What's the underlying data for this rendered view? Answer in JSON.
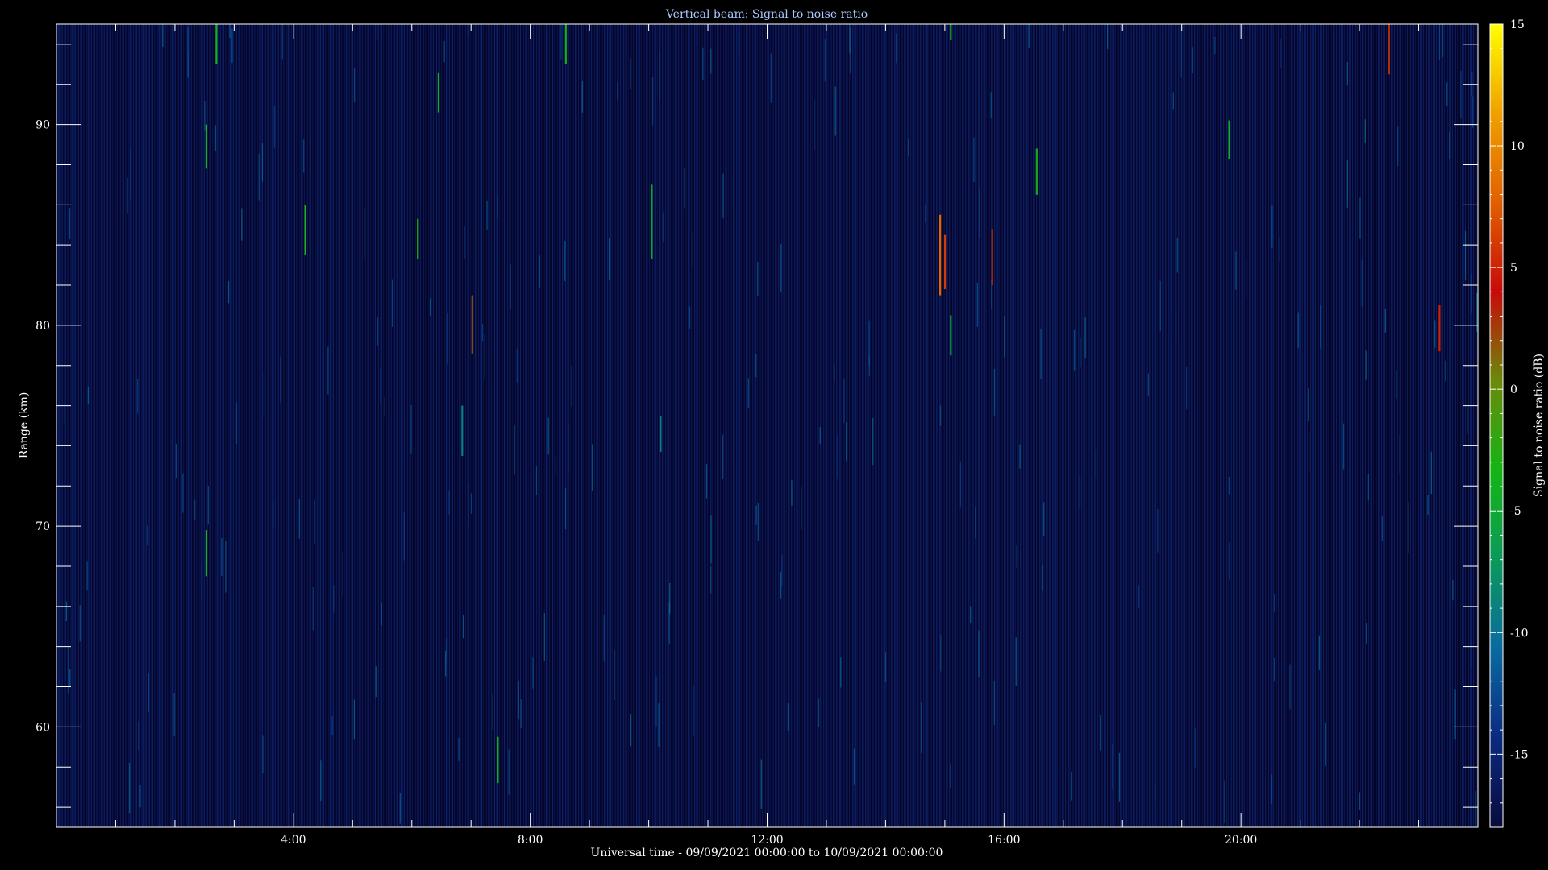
{
  "chart_data": [
    {
      "type": "heatmap",
      "title": "Vertical beam: Signal to noise ratio",
      "xlabel": "Universal time - 09/09/2021 00:00:00 to 10/09/2021 00:00:00",
      "ylabel": "Range (km)",
      "xlim": [
        0,
        24
      ],
      "ylim": [
        55,
        95
      ],
      "x_ticks": [
        {
          "value": 4,
          "label": "4:00"
        },
        {
          "value": 8,
          "label": "8:00"
        },
        {
          "value": 12,
          "label": "12:00"
        },
        {
          "value": 16,
          "label": "16:00"
        },
        {
          "value": 20,
          "label": "20:00"
        }
      ],
      "y_ticks": [
        {
          "value": 60,
          "label": "60"
        },
        {
          "value": 70,
          "label": "70"
        },
        {
          "value": 80,
          "label": "80"
        },
        {
          "value": 90,
          "label": "90"
        }
      ],
      "grid": false,
      "background_level_db": -17,
      "colorbar": {
        "label": "Signal to noise ratio (dB)",
        "range": [
          -18,
          15
        ],
        "ticks": [
          {
            "value": 15,
            "label": "15"
          },
          {
            "value": 10,
            "label": "10"
          },
          {
            "value": 5,
            "label": "5"
          },
          {
            "value": 0,
            "label": "0"
          },
          {
            "value": -5,
            "label": "-5"
          },
          {
            "value": -10,
            "label": "-10"
          },
          {
            "value": -15,
            "label": "-15"
          }
        ],
        "colors": [
          "#0a0a3c",
          "#0a2a80",
          "#0a6aa0",
          "#0a9a5a",
          "#14b414",
          "#6a8a0a",
          "#c80a0a",
          "#e06000",
          "#f0a000",
          "#ffff00"
        ]
      },
      "streaks": [
        {
          "time": 2.53,
          "range_from": 87.8,
          "range_to": 90.0,
          "snr": -3
        },
        {
          "time": 2.53,
          "range_from": 67.5,
          "range_to": 69.8,
          "snr": -3
        },
        {
          "time": 2.7,
          "range_from": 93.0,
          "range_to": 95.0,
          "snr": -4
        },
        {
          "time": 4.2,
          "range_from": 83.5,
          "range_to": 86.0,
          "snr": -3
        },
        {
          "time": 6.1,
          "range_from": 83.3,
          "range_to": 85.3,
          "snr": -3
        },
        {
          "time": 6.45,
          "range_from": 90.6,
          "range_to": 92.6,
          "snr": -4
        },
        {
          "time": 7.02,
          "range_from": 78.6,
          "range_to": 81.5,
          "snr": 2
        },
        {
          "time": 7.45,
          "range_from": 57.2,
          "range_to": 59.5,
          "snr": -4
        },
        {
          "time": 8.6,
          "range_from": 93.0,
          "range_to": 95.0,
          "snr": -4
        },
        {
          "time": 10.05,
          "range_from": 83.3,
          "range_to": 87.0,
          "snr": -5
        },
        {
          "time": 14.92,
          "range_from": 81.5,
          "range_to": 85.5,
          "snr": 8
        },
        {
          "time": 15.0,
          "range_from": 81.8,
          "range_to": 84.5,
          "snr": 6
        },
        {
          "time": 15.1,
          "range_from": 78.5,
          "range_to": 80.5,
          "snr": -6
        },
        {
          "time": 15.1,
          "range_from": 94.2,
          "range_to": 95.0,
          "snr": -4
        },
        {
          "time": 15.8,
          "range_from": 82.0,
          "range_to": 84.8,
          "snr": 3
        },
        {
          "time": 16.55,
          "range_from": 86.5,
          "range_to": 88.8,
          "snr": -4
        },
        {
          "time": 19.8,
          "range_from": 88.3,
          "range_to": 90.2,
          "snr": -4
        },
        {
          "time": 22.5,
          "range_from": 92.5,
          "range_to": 95.0,
          "snr": 3
        },
        {
          "time": 23.35,
          "range_from": 78.7,
          "range_to": 81.0,
          "snr": 5
        },
        {
          "time": 6.85,
          "range_from": 73.5,
          "range_to": 76.0,
          "snr": -9
        },
        {
          "time": 10.2,
          "range_from": 73.7,
          "range_to": 75.5,
          "snr": -9
        }
      ]
    }
  ]
}
